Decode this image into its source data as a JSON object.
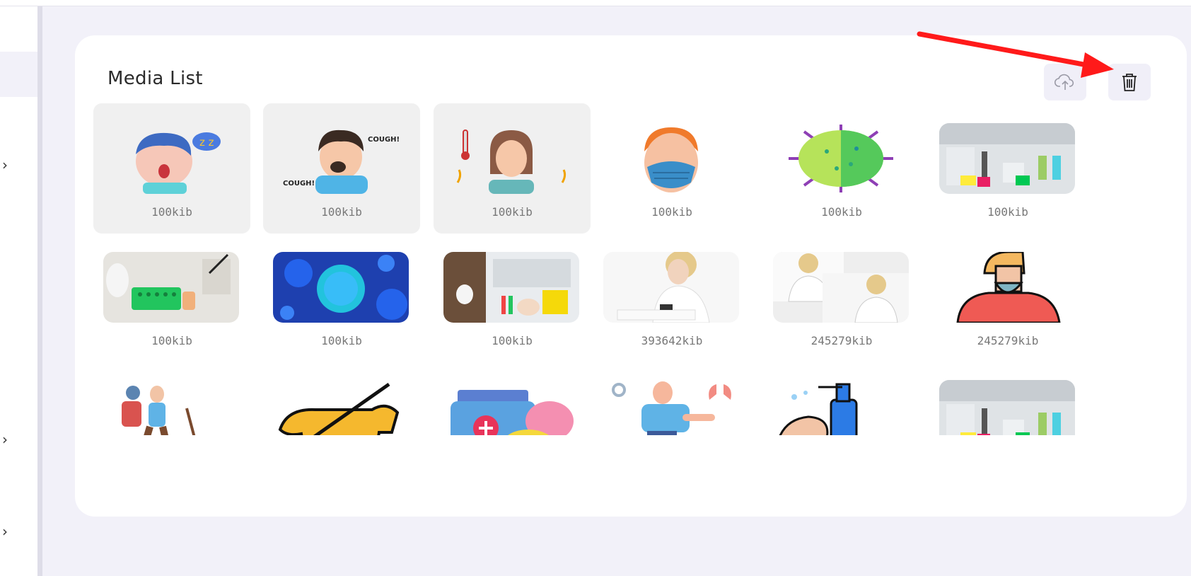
{
  "media_list": {
    "title": "Media List",
    "upload_icon": "cloud-upload-icon",
    "delete_icon": "trash-icon",
    "items": [
      {
        "size": "100kib",
        "picture": "sleepy-boy-illustration",
        "selected": true
      },
      {
        "size": "100kib",
        "picture": "coughing-man-illustration",
        "selected": true
      },
      {
        "size": "100kib",
        "picture": "feverish-woman-illustration",
        "selected": true
      },
      {
        "size": "100kib",
        "picture": "man-with-mask-illustration",
        "selected": false
      },
      {
        "size": "100kib",
        "picture": "virus-illustration",
        "selected": false
      },
      {
        "size": "100kib",
        "picture": "lab-photo",
        "selected": false
      },
      {
        "size": "100kib",
        "picture": "lab-test-tubes-photo",
        "selected": false
      },
      {
        "size": "100kib",
        "picture": "blue-virus-photo",
        "selected": false
      },
      {
        "size": "100kib",
        "picture": "lab-bench-photo",
        "selected": false
      },
      {
        "size": "393642kib",
        "picture": "nurse-writing-photo",
        "selected": false
      },
      {
        "size": "245279kib",
        "picture": "nurse-writing-collage-photo",
        "selected": false
      },
      {
        "size": "245279kib",
        "picture": "bearded-man-illustration",
        "selected": false
      },
      {
        "size": "",
        "picture": "hiker-illustration",
        "selected": false
      },
      {
        "size": "",
        "picture": "no-dogs-illustration",
        "selected": false
      },
      {
        "size": "",
        "picture": "medicine-illustration",
        "selected": false
      },
      {
        "size": "",
        "picture": "lungs-man-illustration",
        "selected": false
      },
      {
        "size": "",
        "picture": "hand-wash-illustration",
        "selected": false
      },
      {
        "size": "",
        "picture": "lab-photo",
        "selected": false
      }
    ]
  },
  "annotation": {
    "arrow_color": "#ff1a1a"
  }
}
